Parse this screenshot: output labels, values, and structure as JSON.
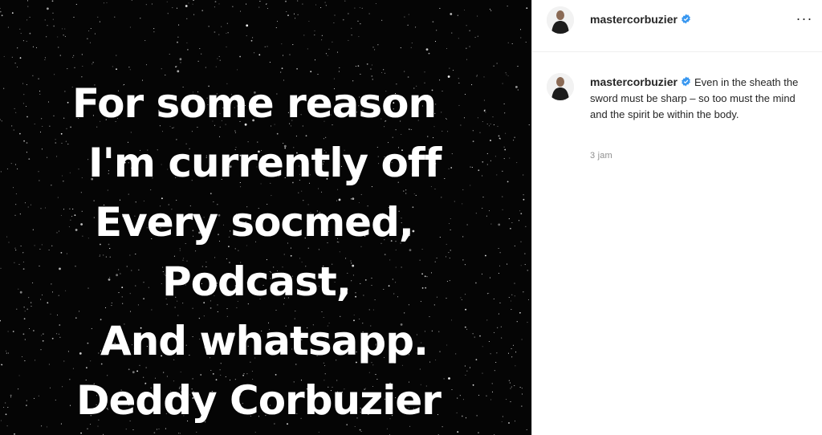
{
  "post": {
    "image_lines": [
      "For some reason",
      "I'm currently off",
      "Every socmed,",
      "Podcast,",
      "And whatsapp.",
      "Deddy Corbuzier"
    ],
    "background_color": "#050505",
    "text_color": "#ffffff"
  },
  "header": {
    "username": "mastercorbuzier",
    "verified_icon": "verified-badge-icon",
    "more_icon": "more-options-icon",
    "more_label": "···"
  },
  "caption": {
    "username": "mastercorbuzier",
    "text": "Even in the sheath the sword must be sharp – so too must the mind and the spirit be within the body.",
    "timestamp": "3 jam"
  },
  "colors": {
    "verified": "#3897f0",
    "username": "#262626",
    "muted": "#8e8e8e",
    "divider": "#dbdbdb"
  }
}
